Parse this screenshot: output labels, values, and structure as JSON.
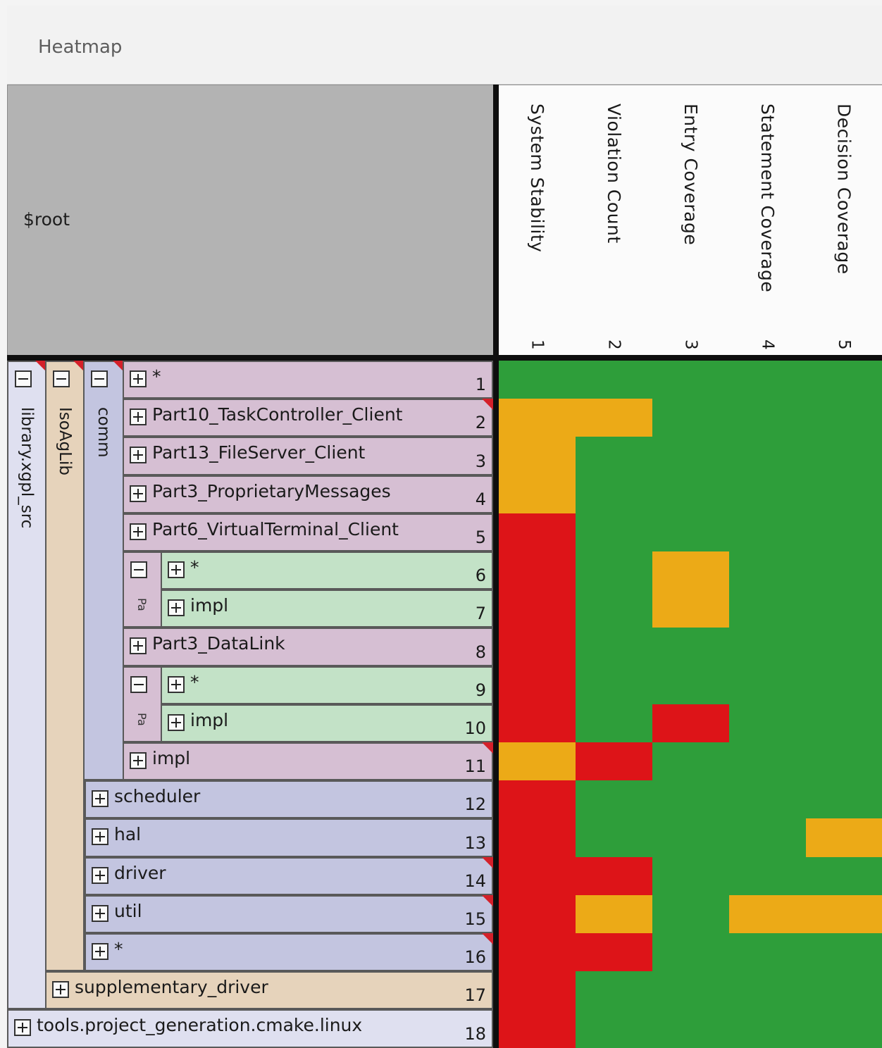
{
  "window": {
    "title": "Heatmap"
  },
  "root_label": "$root",
  "colors": {
    "green": "#2e9e3a",
    "orange": "#ecaa17",
    "red": "#dd1418",
    "group_library": "#dfe0f0",
    "group_isoaglib": "#e6d3bb",
    "group_comm": "#c3c5e0",
    "row_comm_child": "#d6bfd3",
    "row_part": "#c3e2c7",
    "row_blue": "#c3c5e0",
    "row_tan": "#e6d3bb",
    "row_library": "#dfe0f0"
  },
  "columns": [
    {
      "label": "System Stability",
      "num": "1"
    },
    {
      "label": "Violation Count",
      "num": "2"
    },
    {
      "label": "Entry Coverage",
      "num": "3"
    },
    {
      "label": "Statement Coverage",
      "num": "4"
    },
    {
      "label": "Decision Coverage",
      "num": "5"
    }
  ],
  "groups": [
    {
      "name": "library.xgpl_src"
    },
    {
      "name": "IsoAgLib"
    },
    {
      "name": "comm"
    },
    {
      "name": "Pa"
    },
    {
      "name": "Pa"
    }
  ],
  "rows": [
    {
      "label": "*",
      "num": "1",
      "flag": false
    },
    {
      "label": "Part10_TaskController_Client",
      "num": "2",
      "flag": true
    },
    {
      "label": "Part13_FileServer_Client",
      "num": "3",
      "flag": false
    },
    {
      "label": "Part3_ProprietaryMessages",
      "num": "4",
      "flag": false
    },
    {
      "label": "Part6_VirtualTerminal_Client",
      "num": "5",
      "flag": false
    },
    {
      "label": "*",
      "num": "6",
      "flag": false
    },
    {
      "label": "impl",
      "num": "7",
      "flag": false
    },
    {
      "label": "Part3_DataLink",
      "num": "8",
      "flag": false
    },
    {
      "label": "*",
      "num": "9",
      "flag": false
    },
    {
      "label": "impl",
      "num": "10",
      "flag": false
    },
    {
      "label": "impl",
      "num": "11",
      "flag": true
    },
    {
      "label": "scheduler",
      "num": "12",
      "flag": false
    },
    {
      "label": "hal",
      "num": "13",
      "flag": false
    },
    {
      "label": "driver",
      "num": "14",
      "flag": true
    },
    {
      "label": "util",
      "num": "15",
      "flag": true
    },
    {
      "label": "*",
      "num": "16",
      "flag": true
    },
    {
      "label": "supplementary_driver",
      "num": "17",
      "flag": false
    },
    {
      "label": "tools.project_generation.cmake.linux",
      "num": "18",
      "flag": false
    }
  ],
  "heatmap": [
    [
      "G",
      "G",
      "G",
      "G",
      "G"
    ],
    [
      "O",
      "O",
      "G",
      "G",
      "G"
    ],
    [
      "O",
      "G",
      "G",
      "G",
      "G"
    ],
    [
      "O",
      "G",
      "G",
      "G",
      "G"
    ],
    [
      "R",
      "G",
      "G",
      "G",
      "G"
    ],
    [
      "R",
      "G",
      "O",
      "G",
      "G"
    ],
    [
      "R",
      "G",
      "O",
      "G",
      "G"
    ],
    [
      "R",
      "G",
      "G",
      "G",
      "G"
    ],
    [
      "R",
      "G",
      "G",
      "G",
      "G"
    ],
    [
      "R",
      "G",
      "R",
      "G",
      "G"
    ],
    [
      "O",
      "R",
      "G",
      "G",
      "G"
    ],
    [
      "R",
      "G",
      "G",
      "G",
      "G"
    ],
    [
      "R",
      "G",
      "G",
      "G",
      "O"
    ],
    [
      "R",
      "R",
      "G",
      "G",
      "G"
    ],
    [
      "R",
      "O",
      "G",
      "O",
      "O"
    ],
    [
      "R",
      "R",
      "G",
      "G",
      "G"
    ],
    [
      "R",
      "G",
      "G",
      "G",
      "G"
    ],
    [
      "R",
      "G",
      "G",
      "G",
      "G"
    ]
  ]
}
